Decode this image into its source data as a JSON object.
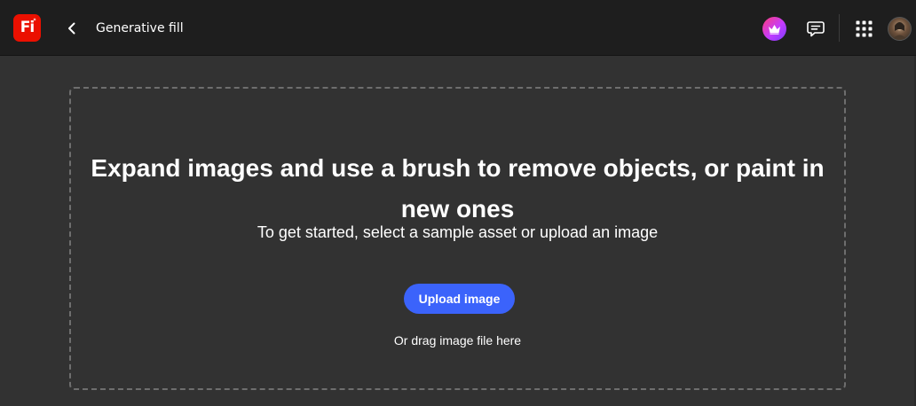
{
  "header": {
    "app_logo_text": "Fi",
    "back_icon": "chevron-left-icon",
    "title": "Generative fill",
    "premium_icon": "crown-icon",
    "feedback_icon": "chat-bubble-icon",
    "apps_icon": "app-grid-icon",
    "avatar_icon": "user-avatar"
  },
  "main": {
    "headline": "Expand images and use a brush to remove objects, or paint in new ones",
    "subhead": "To get started, select a sample asset or upload an image",
    "upload_button_label": "Upload image",
    "drag_hint": "Or drag image file here"
  },
  "colors": {
    "logo_red": "#eb1000",
    "upload_blue": "#3b63fb",
    "topbar_bg": "#1e1e1e",
    "canvas_bg": "#323232"
  }
}
